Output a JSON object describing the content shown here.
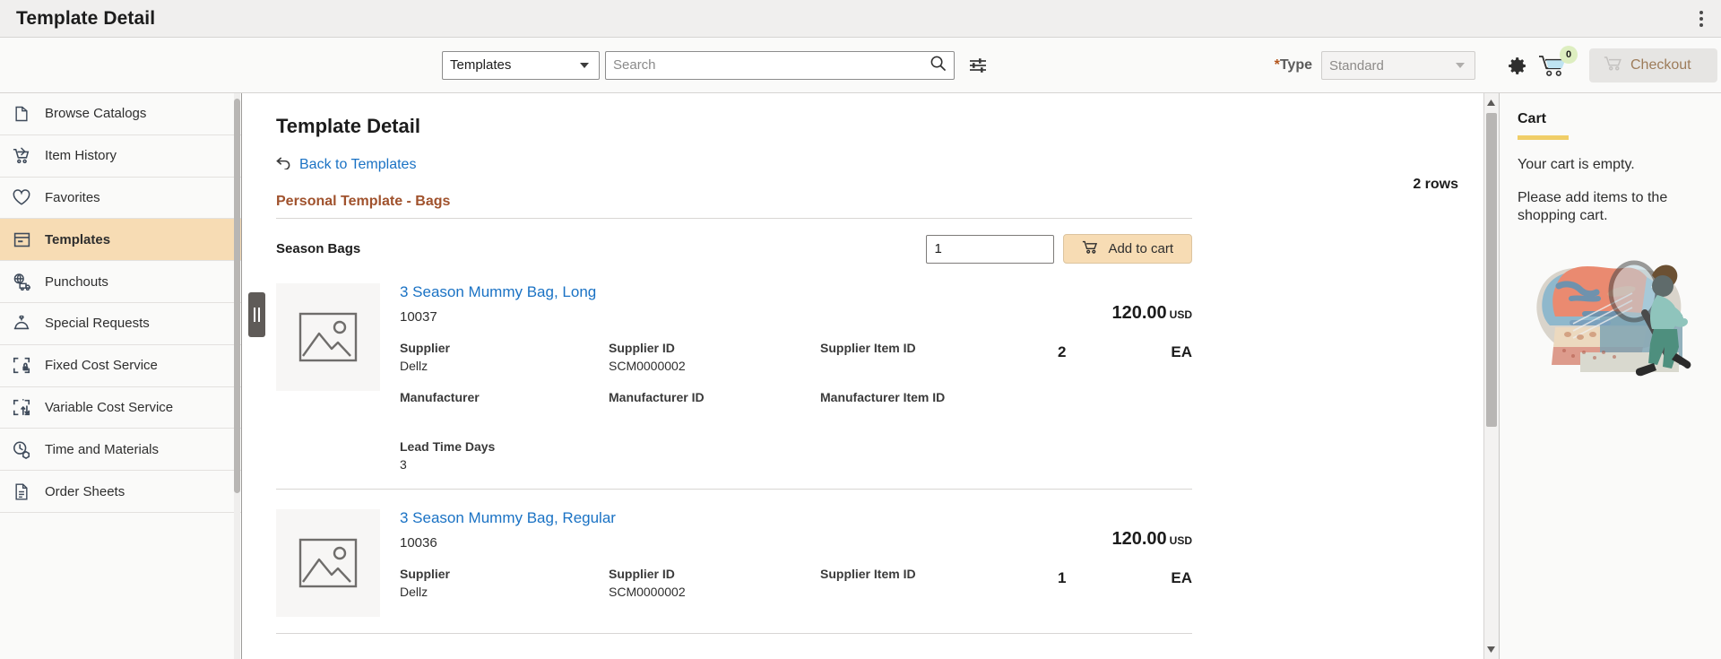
{
  "window": {
    "title": "Template Detail",
    "menu_icon": "kebab-menu-icon"
  },
  "toolbar": {
    "scope_select": {
      "value": "Templates",
      "options": [
        "Templates"
      ]
    },
    "search": {
      "value": "",
      "placeholder": "Search",
      "icon": "search-icon"
    },
    "filter_icon": "filter-sliders-icon",
    "type": {
      "label": "Type",
      "required_marker": "*",
      "value": "Standard",
      "options": [
        "Standard"
      ]
    },
    "settings_icon": "gear-icon",
    "cart_icon": "shopping-cart-icon",
    "cart_count": "0",
    "checkout_label": "Checkout"
  },
  "sidebar": {
    "items": [
      {
        "label": "Browse Catalogs",
        "icon": "book-open-icon",
        "active": false
      },
      {
        "label": "Item History",
        "icon": "cart-history-icon",
        "active": false
      },
      {
        "label": "Favorites",
        "icon": "heart-icon",
        "active": false
      },
      {
        "label": "Templates",
        "icon": "template-window-icon",
        "active": true
      },
      {
        "label": "Punchouts",
        "icon": "globe-truck-icon",
        "active": false
      },
      {
        "label": "Special Requests",
        "icon": "service-bell-icon",
        "active": false
      },
      {
        "label": "Fixed Cost Service",
        "icon": "frame-lock-icon",
        "active": false
      },
      {
        "label": "Variable Cost Service",
        "icon": "frame-arrows-icon",
        "active": false
      },
      {
        "label": "Time and Materials",
        "icon": "clock-box-icon",
        "active": false
      },
      {
        "label": "Order Sheets",
        "icon": "document-lines-icon",
        "active": false
      }
    ],
    "collapse_handle": "panel-collapse-handle"
  },
  "main": {
    "page_title": "Template Detail",
    "back_link": "Back to Templates",
    "back_icon": "back-arrow-icon",
    "rows_count": "2 rows",
    "template_name": "Personal Template - Bags",
    "group": {
      "name": "Season Bags",
      "qty_value": "1",
      "add_to_cart_label": "Add to cart",
      "add_to_cart_icon": "cart-icon"
    },
    "attr_labels": {
      "supplier": "Supplier",
      "supplier_id": "Supplier ID",
      "supplier_item_id": "Supplier Item ID",
      "manufacturer": "Manufacturer",
      "manufacturer_id": "Manufacturer ID",
      "manufacturer_item_id": "Manufacturer Item ID",
      "lead_time": "Lead Time Days"
    },
    "items": [
      {
        "name": "3 Season Mummy Bag, Long",
        "sku": "10037",
        "thumb_icon": "image-placeholder-icon",
        "supplier": "Dellz",
        "supplier_id": "SCM0000002",
        "supplier_item_id": "",
        "manufacturer": "",
        "manufacturer_id": "",
        "manufacturer_item_id": "",
        "lead_time_days": "3",
        "price": "120.00",
        "currency": "USD",
        "qty": "2",
        "uom": "EA"
      },
      {
        "name": "3 Season Mummy Bag, Regular",
        "sku": "10036",
        "thumb_icon": "image-placeholder-icon",
        "supplier": "Dellz",
        "supplier_id": "SCM0000002",
        "supplier_item_id": "",
        "manufacturer": "",
        "manufacturer_id": "",
        "manufacturer_item_id": "",
        "lead_time_days": "",
        "price": "120.00",
        "currency": "USD",
        "qty": "1",
        "uom": "EA"
      }
    ]
  },
  "cart": {
    "title": "Cart",
    "empty_message": "Your cart is empty.",
    "hint_message": "Please add items to the shopping cart.",
    "illustration": "person-magnifying-glass-illustration"
  },
  "colors": {
    "accent_tan": "#f7dcb4",
    "link_blue": "#1a72c4",
    "template_brown": "#a0522d",
    "cart_rule_gold": "#f0ce68",
    "badge_green": "#ddeec0"
  }
}
